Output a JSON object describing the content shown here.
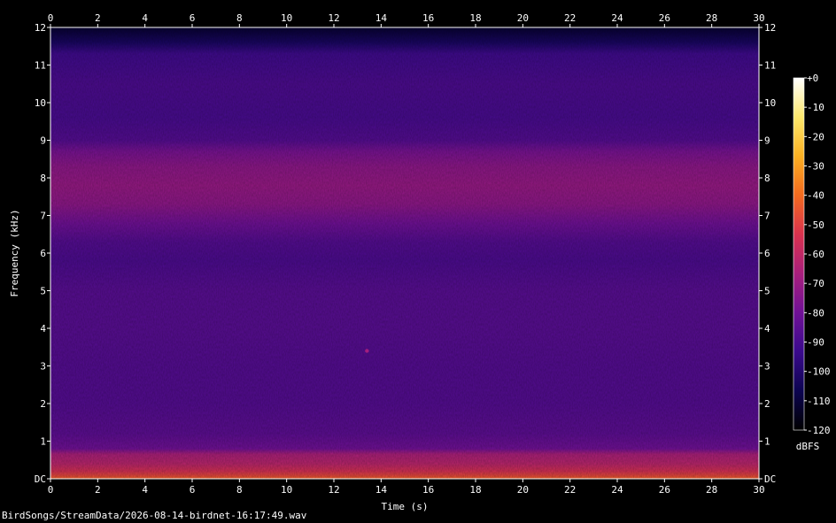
{
  "file_label": "BirdSongs/StreamData/2026-08-14-birdnet-16:17:49.wav",
  "chart_data": {
    "type": "heatmap",
    "xlabel": "Time (s)",
    "ylabel": "Frequency (kHz)",
    "xlim": [
      0,
      30
    ],
    "ylim": [
      0,
      12
    ],
    "x_ticks": [
      0,
      2,
      4,
      6,
      8,
      10,
      12,
      14,
      16,
      18,
      20,
      22,
      24,
      26,
      28,
      30
    ],
    "y_ticks": [
      0,
      1,
      2,
      3,
      4,
      5,
      6,
      7,
      8,
      9,
      10,
      11,
      12
    ],
    "y_tick_labels": [
      "DC",
      "1",
      "2",
      "3",
      "4",
      "5",
      "6",
      "7",
      "8",
      "9",
      "10",
      "11",
      "12"
    ],
    "colorbar": {
      "label": "dBFS",
      "range": [
        -120,
        0
      ],
      "ticks": [
        "+0",
        "-10",
        "-20",
        "-30",
        "-40",
        "-50",
        "-60",
        "-70",
        "-80",
        "-90",
        "-100",
        "-110",
        "-120"
      ],
      "colors": [
        "#000000",
        "#0c0450",
        "#3a0a8c",
        "#701196",
        "#a81f7c",
        "#d9324e",
        "#f36a1f",
        "#fbb022",
        "#fde86c",
        "#ffffff"
      ]
    },
    "frequency_profile_db": [
      {
        "khz": 0.0,
        "db": -42
      },
      {
        "khz": 0.08,
        "db": -48
      },
      {
        "khz": 0.2,
        "db": -55
      },
      {
        "khz": 0.4,
        "db": -62
      },
      {
        "khz": 0.65,
        "db": -66
      },
      {
        "khz": 0.8,
        "db": -80
      },
      {
        "khz": 1.2,
        "db": -85
      },
      {
        "khz": 2.0,
        "db": -87
      },
      {
        "khz": 3.0,
        "db": -87
      },
      {
        "khz": 4.0,
        "db": -86
      },
      {
        "khz": 5.0,
        "db": -86
      },
      {
        "khz": 5.8,
        "db": -89
      },
      {
        "khz": 6.3,
        "db": -87
      },
      {
        "khz": 6.8,
        "db": -80
      },
      {
        "khz": 7.3,
        "db": -73
      },
      {
        "khz": 7.8,
        "db": -71
      },
      {
        "khz": 8.3,
        "db": -73
      },
      {
        "khz": 8.7,
        "db": -78
      },
      {
        "khz": 9.0,
        "db": -87
      },
      {
        "khz": 9.6,
        "db": -90
      },
      {
        "khz": 10.5,
        "db": -89
      },
      {
        "khz": 11.3,
        "db": -92
      },
      {
        "khz": 11.6,
        "db": -103
      },
      {
        "khz": 12.0,
        "db": -112
      }
    ],
    "annotations": [
      {
        "type": "point",
        "x": 13.4,
        "y": 3.4,
        "db": -68
      }
    ]
  }
}
